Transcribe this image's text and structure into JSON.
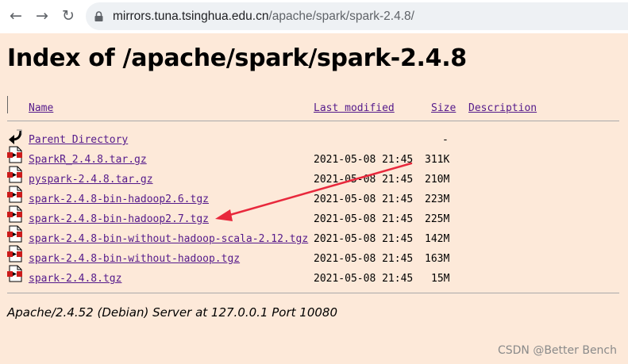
{
  "browser": {
    "url_host": "mirrors.tuna.tsinghua.edu.cn",
    "url_path": "/apache/spark/spark-2.4.8/"
  },
  "page": {
    "title": "Index of /apache/spark/spark-2.4.8",
    "columns": {
      "name": "Name",
      "last_modified": "Last modified",
      "size": "Size",
      "description": "Description"
    },
    "parent": {
      "name": "Parent Directory",
      "size": "-"
    },
    "rows": [
      {
        "name": "SparkR_2.4.8.tar.gz",
        "modified": "2021-05-08 21:45",
        "size": "311K"
      },
      {
        "name": "pyspark-2.4.8.tar.gz",
        "modified": "2021-05-08 21:45",
        "size": "210M"
      },
      {
        "name": "spark-2.4.8-bin-hadoop2.6.tgz",
        "modified": "2021-05-08 21:45",
        "size": "223M"
      },
      {
        "name": "spark-2.4.8-bin-hadoop2.7.tgz",
        "modified": "2021-05-08 21:45",
        "size": "225M"
      },
      {
        "name": "spark-2.4.8-bin-without-hadoop-scala-2.12.tgz",
        "modified": "2021-05-08 21:45",
        "size": "142M"
      },
      {
        "name": "spark-2.4.8-bin-without-hadoop.tgz",
        "modified": "2021-05-08 21:45",
        "size": "163M"
      },
      {
        "name": "spark-2.4.8.tgz",
        "modified": "2021-05-08 21:45",
        "size": "15M"
      }
    ],
    "footer": "Apache/2.4.52 (Debian) Server at 127.0.0.1 Port 10080"
  },
  "watermark": "CSDN @Better Bench",
  "colors": {
    "page_background": "#fde9d9",
    "link": "#551a8b",
    "annotation_arrow": "#e8283c"
  }
}
